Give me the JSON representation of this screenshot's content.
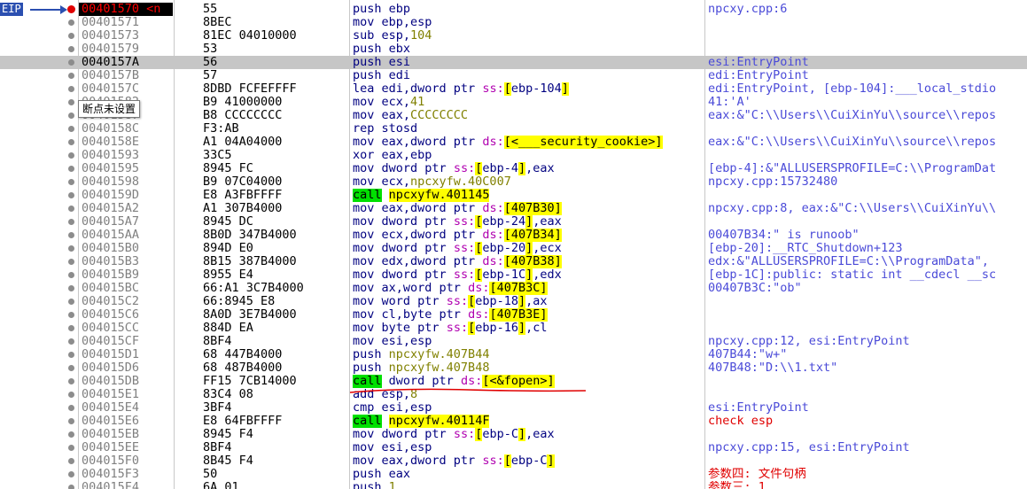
{
  "eip_label": "EIP",
  "tooltip": "断点未设置",
  "rows": [
    {
      "addr": "00401570 <n",
      "bytes": "55",
      "cmt": "npcxy.cpp:6",
      "cmt_color": "blue",
      "eip": true,
      "bp": true,
      "ins": [
        [
          "push",
          "mnem"
        ],
        [
          " ebp",
          "reg"
        ]
      ]
    },
    {
      "addr": "00401571",
      "bytes": "8BEC",
      "cmt": "",
      "ins": [
        [
          "mov",
          "mnem"
        ],
        [
          " ebp,esp",
          "reg"
        ]
      ]
    },
    {
      "addr": "00401573",
      "bytes": "81EC 04010000",
      "cmt": "",
      "ins": [
        [
          "sub",
          "mnem"
        ],
        [
          " esp,",
          "reg"
        ],
        [
          "104",
          "num"
        ]
      ]
    },
    {
      "addr": "00401579",
      "bytes": "53",
      "cmt": "",
      "ins": [
        [
          "push",
          "mnem"
        ],
        [
          " ebx",
          "reg"
        ]
      ]
    },
    {
      "addr": "0040157A",
      "bytes": "56",
      "cmt": "esi:EntryPoint",
      "cmt_color": "blue",
      "selected": true,
      "ins": [
        [
          "push",
          "mnem"
        ],
        [
          " esi",
          "reg"
        ]
      ]
    },
    {
      "addr": "0040157B",
      "bytes": "57",
      "cmt": "edi:EntryPoint",
      "cmt_color": "blue",
      "ins": [
        [
          "push",
          "mnem"
        ],
        [
          " edi",
          "reg"
        ]
      ]
    },
    {
      "addr": "0040157C",
      "bytes": "8DBD FCFEFFFF",
      "cmt": "edi:EntryPoint, [ebp-104]:___local_stdio",
      "cmt_color": "blue",
      "ins": [
        [
          "lea",
          "mnem"
        ],
        [
          " edi,",
          "reg"
        ],
        [
          "dword ptr",
          "ptr"
        ],
        [
          " ss:",
          "seg"
        ],
        [
          "[",
          "br"
        ],
        [
          "ebp-104",
          "reg"
        ],
        [
          "]",
          "br"
        ]
      ]
    },
    {
      "addr": "00401582",
      "bytes": "B9 41000000",
      "cmt": "41:'A'",
      "cmt_color": "blue",
      "ins": [
        [
          "mov",
          "mnem"
        ],
        [
          " ecx,",
          "reg"
        ],
        [
          "41",
          "num"
        ]
      ]
    },
    {
      "addr": "00401587",
      "bytes": "B8 CCCCCCCC",
      "cmt": "eax:&\"C:\\\\Users\\\\CuiXinYu\\\\source\\\\repos",
      "cmt_color": "blue",
      "ins": [
        [
          "mov",
          "mnem"
        ],
        [
          " eax,",
          "reg"
        ],
        [
          "CCCCCCCC",
          "num"
        ]
      ]
    },
    {
      "addr": "0040158C",
      "bytes": "F3:AB",
      "cmt": "",
      "ins": [
        [
          "rep stosd",
          "mnem"
        ]
      ]
    },
    {
      "addr": "0040158E",
      "bytes": "A1 04A04000",
      "cmt": "eax:&\"C:\\\\Users\\\\CuiXinYu\\\\source\\\\repos",
      "cmt_color": "blue",
      "ins": [
        [
          "mov",
          "mnem"
        ],
        [
          " eax,",
          "reg"
        ],
        [
          "dword ptr",
          "ptr"
        ],
        [
          " ds:",
          "seg"
        ],
        [
          "[",
          "br"
        ],
        [
          "<___security_cookie>",
          "hl"
        ],
        [
          "]",
          "br"
        ]
      ]
    },
    {
      "addr": "00401593",
      "bytes": "33C5",
      "cmt": "",
      "ins": [
        [
          "xor",
          "mnem"
        ],
        [
          " eax,ebp",
          "reg"
        ]
      ]
    },
    {
      "addr": "00401595",
      "bytes": "8945 FC",
      "cmt": "[ebp-4]:&\"ALLUSERSPROFILE=C:\\\\ProgramDat",
      "cmt_color": "blue",
      "ins": [
        [
          "mov",
          "mnem"
        ],
        [
          " ",
          "reg"
        ],
        [
          "dword ptr",
          "ptr"
        ],
        [
          " ss:",
          "seg"
        ],
        [
          "[",
          "br"
        ],
        [
          "ebp-4",
          "reg"
        ],
        [
          "]",
          "br"
        ],
        [
          ",eax",
          "reg"
        ]
      ]
    },
    {
      "addr": "00401598",
      "bytes": "B9 07C04000",
      "cmt": "npcxy.cpp:15732480",
      "cmt_color": "blue",
      "ins": [
        [
          "mov",
          "mnem"
        ],
        [
          " ecx,",
          "reg"
        ],
        [
          "npcxyfw.40C007",
          "num"
        ]
      ]
    },
    {
      "addr": "0040159D",
      "bytes": "E8 A3FBFFFF",
      "cmt": "",
      "ins": [
        [
          "call",
          "call"
        ],
        [
          " ",
          "reg"
        ],
        [
          "npcxyfw.401145",
          "hl"
        ]
      ]
    },
    {
      "addr": "004015A2",
      "bytes": "A1 307B4000",
      "cmt": "npcxy.cpp:8, eax:&\"C:\\\\Users\\\\CuiXinYu\\\\",
      "cmt_color": "blue",
      "ins": [
        [
          "mov",
          "mnem"
        ],
        [
          " eax,",
          "reg"
        ],
        [
          "dword ptr",
          "ptr"
        ],
        [
          " ds:",
          "seg"
        ],
        [
          "[",
          "br"
        ],
        [
          "407B30",
          "hl"
        ],
        [
          "]",
          "br"
        ]
      ]
    },
    {
      "addr": "004015A7",
      "bytes": "8945 DC",
      "cmt": "",
      "ins": [
        [
          "mov",
          "mnem"
        ],
        [
          " ",
          "reg"
        ],
        [
          "dword ptr",
          "ptr"
        ],
        [
          " ss:",
          "seg"
        ],
        [
          "[",
          "br"
        ],
        [
          "ebp-24",
          "reg"
        ],
        [
          "]",
          "br"
        ],
        [
          ",eax",
          "reg"
        ]
      ]
    },
    {
      "addr": "004015AA",
      "bytes": "8B0D 347B4000",
      "cmt": "00407B34:\" is runoob\"",
      "cmt_color": "blue",
      "ins": [
        [
          "mov",
          "mnem"
        ],
        [
          " ecx,",
          "reg"
        ],
        [
          "dword ptr",
          "ptr"
        ],
        [
          " ds:",
          "seg"
        ],
        [
          "[",
          "br"
        ],
        [
          "407B34",
          "hl"
        ],
        [
          "]",
          "br"
        ]
      ]
    },
    {
      "addr": "004015B0",
      "bytes": "894D E0",
      "cmt": "[ebp-20]:__RTC_Shutdown+123",
      "cmt_color": "blue",
      "ins": [
        [
          "mov",
          "mnem"
        ],
        [
          " ",
          "reg"
        ],
        [
          "dword ptr",
          "ptr"
        ],
        [
          " ss:",
          "seg"
        ],
        [
          "[",
          "br"
        ],
        [
          "ebp-20",
          "reg"
        ],
        [
          "]",
          "br"
        ],
        [
          ",ecx",
          "reg"
        ]
      ]
    },
    {
      "addr": "004015B3",
      "bytes": "8B15 387B4000",
      "cmt": "edx:&\"ALLUSERSPROFILE=C:\\\\ProgramData\",",
      "cmt_color": "blue",
      "ins": [
        [
          "mov",
          "mnem"
        ],
        [
          " edx,",
          "reg"
        ],
        [
          "dword ptr",
          "ptr"
        ],
        [
          " ds:",
          "seg"
        ],
        [
          "[",
          "br"
        ],
        [
          "407B38",
          "hl"
        ],
        [
          "]",
          "br"
        ]
      ]
    },
    {
      "addr": "004015B9",
      "bytes": "8955 E4",
      "cmt": "[ebp-1C]:public: static int __cdecl __sc",
      "cmt_color": "blue",
      "ins": [
        [
          "mov",
          "mnem"
        ],
        [
          " ",
          "reg"
        ],
        [
          "dword ptr",
          "ptr"
        ],
        [
          " ss:",
          "seg"
        ],
        [
          "[",
          "br"
        ],
        [
          "ebp-1C",
          "reg"
        ],
        [
          "]",
          "br"
        ],
        [
          ",edx",
          "reg"
        ]
      ]
    },
    {
      "addr": "004015BC",
      "bytes": "66:A1 3C7B4000",
      "cmt": "00407B3C:\"ob\"",
      "cmt_color": "blue",
      "ins": [
        [
          "mov",
          "mnem"
        ],
        [
          " ax,",
          "reg"
        ],
        [
          "word ptr",
          "ptr"
        ],
        [
          " ds:",
          "seg"
        ],
        [
          "[",
          "br"
        ],
        [
          "407B3C",
          "hl"
        ],
        [
          "]",
          "br"
        ]
      ]
    },
    {
      "addr": "004015C2",
      "bytes": "66:8945 E8",
      "cmt": "",
      "ins": [
        [
          "mov",
          "mnem"
        ],
        [
          " ",
          "reg"
        ],
        [
          "word ptr",
          "ptr"
        ],
        [
          " ss:",
          "seg"
        ],
        [
          "[",
          "br"
        ],
        [
          "ebp-18",
          "reg"
        ],
        [
          "]",
          "br"
        ],
        [
          ",ax",
          "reg"
        ]
      ]
    },
    {
      "addr": "004015C6",
      "bytes": "8A0D 3E7B4000",
      "cmt": "",
      "ins": [
        [
          "mov",
          "mnem"
        ],
        [
          " cl,",
          "reg"
        ],
        [
          "byte ptr",
          "ptr"
        ],
        [
          " ds:",
          "seg"
        ],
        [
          "[",
          "br"
        ],
        [
          "407B3E",
          "hl"
        ],
        [
          "]",
          "br"
        ]
      ]
    },
    {
      "addr": "004015CC",
      "bytes": "884D EA",
      "cmt": "",
      "ins": [
        [
          "mov",
          "mnem"
        ],
        [
          " ",
          "reg"
        ],
        [
          "byte ptr",
          "ptr"
        ],
        [
          " ss:",
          "seg"
        ],
        [
          "[",
          "br"
        ],
        [
          "ebp-16",
          "reg"
        ],
        [
          "]",
          "br"
        ],
        [
          ",cl",
          "reg"
        ]
      ]
    },
    {
      "addr": "004015CF",
      "bytes": "8BF4",
      "cmt": "npcxy.cpp:12, esi:EntryPoint",
      "cmt_color": "blue",
      "ins": [
        [
          "mov",
          "mnem"
        ],
        [
          " esi,esp",
          "reg"
        ]
      ]
    },
    {
      "addr": "004015D1",
      "bytes": "68 447B4000",
      "cmt": "407B44:\"w+\"",
      "cmt_color": "blue",
      "ins": [
        [
          "push",
          "mnem"
        ],
        [
          " ",
          "reg"
        ],
        [
          "npcxyfw.407B44",
          "num"
        ]
      ]
    },
    {
      "addr": "004015D6",
      "bytes": "68 487B4000",
      "cmt": "407B48:\"D:\\\\1.txt\"",
      "cmt_color": "blue",
      "ins": [
        [
          "push",
          "mnem"
        ],
        [
          " ",
          "reg"
        ],
        [
          "npcxyfw.407B48",
          "num"
        ]
      ]
    },
    {
      "addr": "004015DB",
      "bytes": "FF15 7CB14000",
      "cmt": "",
      "ins": [
        [
          "call",
          "call"
        ],
        [
          " ",
          "reg"
        ],
        [
          "dword ptr",
          "ptr"
        ],
        [
          " ds:",
          "seg"
        ],
        [
          "[",
          "br"
        ],
        [
          "<&fopen>",
          "hl"
        ],
        [
          "]",
          "br"
        ]
      ]
    },
    {
      "addr": "004015E1",
      "bytes": "83C4 08",
      "cmt": "",
      "ins": [
        [
          "add",
          "mnem"
        ],
        [
          " esp,",
          "reg"
        ],
        [
          "8",
          "num"
        ]
      ]
    },
    {
      "addr": "004015E4",
      "bytes": "3BF4",
      "cmt": "esi:EntryPoint",
      "cmt_color": "blue",
      "ins": [
        [
          "cmp",
          "mnem"
        ],
        [
          " esi,esp",
          "reg"
        ]
      ]
    },
    {
      "addr": "004015E6",
      "bytes": "E8 64FBFFFF",
      "cmt": "check esp",
      "cmt_color": "red",
      "ins": [
        [
          "call",
          "call"
        ],
        [
          " ",
          "reg"
        ],
        [
          "npcxyfw.40114F",
          "hl"
        ]
      ]
    },
    {
      "addr": "004015EB",
      "bytes": "8945 F4",
      "cmt": "",
      "ins": [
        [
          "mov",
          "mnem"
        ],
        [
          " ",
          "reg"
        ],
        [
          "dword ptr",
          "ptr"
        ],
        [
          " ss:",
          "seg"
        ],
        [
          "[",
          "br"
        ],
        [
          "ebp-C",
          "reg"
        ],
        [
          "]",
          "br"
        ],
        [
          ",eax",
          "reg"
        ]
      ]
    },
    {
      "addr": "004015EE",
      "bytes": "8BF4",
      "cmt": "npcxy.cpp:15, esi:EntryPoint",
      "cmt_color": "blue",
      "ins": [
        [
          "mov",
          "mnem"
        ],
        [
          " esi,esp",
          "reg"
        ]
      ]
    },
    {
      "addr": "004015F0",
      "bytes": "8B45 F4",
      "cmt": "",
      "ins": [
        [
          "mov",
          "mnem"
        ],
        [
          " eax,",
          "reg"
        ],
        [
          "dword ptr",
          "ptr"
        ],
        [
          " ss:",
          "seg"
        ],
        [
          "[",
          "br"
        ],
        [
          "ebp-C",
          "reg"
        ],
        [
          "]",
          "br"
        ]
      ]
    },
    {
      "addr": "004015F3",
      "bytes": "50",
      "cmt": "参数四: 文件句柄",
      "cmt_color": "red",
      "ins": [
        [
          "push",
          "mnem"
        ],
        [
          " eax",
          "reg"
        ]
      ]
    },
    {
      "addr": "004015F4",
      "bytes": "6A 01",
      "cmt": "参数三: 1",
      "cmt_color": "red",
      "ins": [
        [
          "push",
          "mnem"
        ],
        [
          " ",
          "reg"
        ],
        [
          "1",
          "num"
        ]
      ]
    }
  ]
}
